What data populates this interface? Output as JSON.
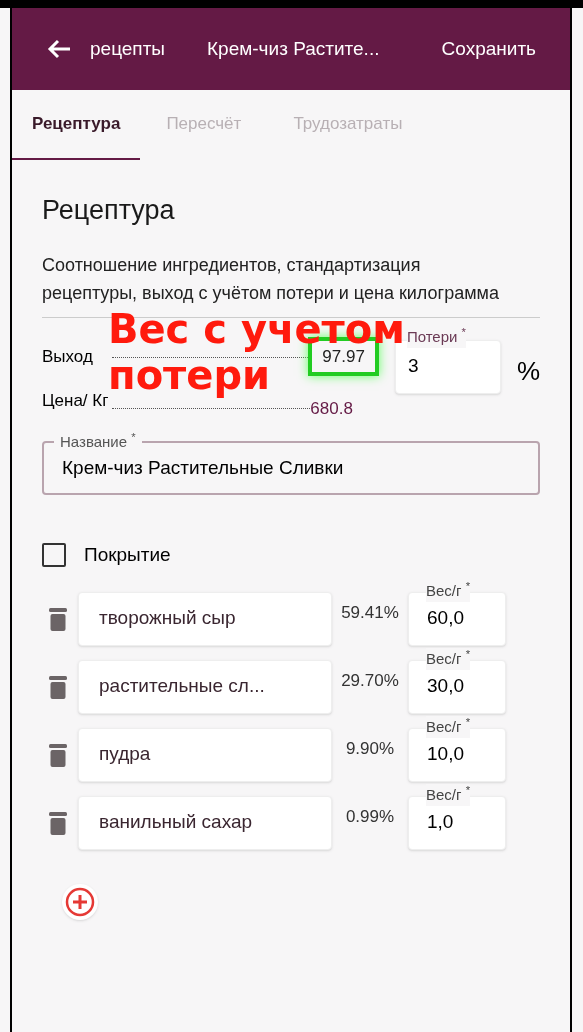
{
  "app_bar": {
    "back_label": "рецепты",
    "title": "Крем-чиз Растите...",
    "action": "Сохранить"
  },
  "tabs": [
    {
      "label": "Рецептура",
      "selected": true
    },
    {
      "label": "Пересчёт",
      "selected": false
    },
    {
      "label": "Трудозатраты",
      "selected": false
    }
  ],
  "section": {
    "title": "Рецептура",
    "description": "Соотношение ингредиентов, стандартизация рецептуры, выход с учётом потери и цена килограмма"
  },
  "yield": {
    "label": "Выход",
    "value": "97.97",
    "highlighted": true
  },
  "price": {
    "label": "Цена/ Кг",
    "value": "680.8"
  },
  "loss": {
    "label": "Потери $^{*}$",
    "value": "3",
    "unit": "%"
  },
  "name_field": {
    "label": "Название $^{*}$",
    "value": "Крем-чиз Растительные Сливки"
  },
  "coating": {
    "label": "Покрытие",
    "checked": false
  },
  "ingredients": [
    {
      "name": "творожный сыр",
      "percent": "59.41%",
      "weight_label": "Вес/г $^{*}$",
      "weight": "60,0"
    },
    {
      "name": "растительные сл...",
      "percent": "29.70%",
      "weight_label": "Вес/г $^{*}$",
      "weight": "30,0"
    },
    {
      "name": "пудра",
      "percent": "9.90%",
      "weight_label": "Вес/г $^{*}$",
      "weight": "10,0"
    },
    {
      "name": "ванильный сахар",
      "percent": "0.99%",
      "weight_label": "Вес/г $^{*}$",
      "weight": "1,0"
    }
  ],
  "annotation": {
    "lines": [
      "Вес с учетом",
      "потери"
    ]
  }
}
